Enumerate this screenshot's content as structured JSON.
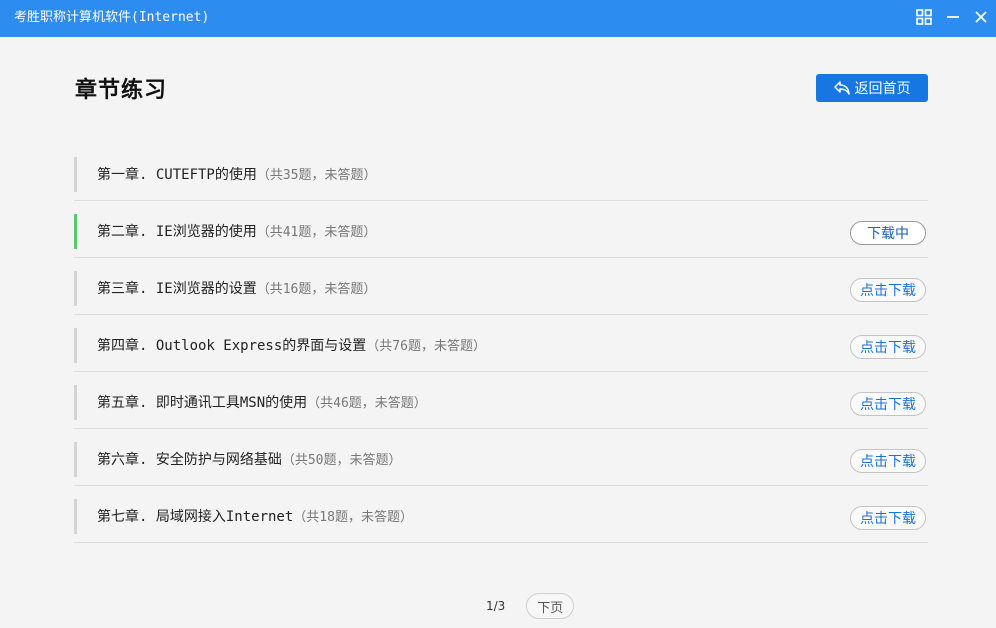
{
  "window": {
    "title": "考胜职称计算机软件(Internet)",
    "controls": {
      "grid_icon": "grid-icon",
      "minimize_icon": "minimize-icon",
      "close_icon": "close-icon"
    }
  },
  "header": {
    "title": "章节练习",
    "home_button": {
      "label": "返回首页",
      "icon": "return-arrow-icon"
    }
  },
  "chapters": [
    {
      "title": "第一章. CUTEFTP的使用",
      "meta": "（共35题，未答题）",
      "active": false,
      "action": ""
    },
    {
      "title": "第二章. IE浏览器的使用",
      "meta": "（共41题，未答题）",
      "active": true,
      "action": "下载中"
    },
    {
      "title": "第三章. IE浏览器的设置",
      "meta": "（共16题，未答题）",
      "active": false,
      "action": "点击下载"
    },
    {
      "title": "第四章. Outlook Express的界面与设置",
      "meta": "（共76题，未答题）",
      "active": false,
      "action": "点击下载"
    },
    {
      "title": "第五章. 即时通讯工具MSN的使用",
      "meta": "（共46题，未答题）",
      "active": false,
      "action": "点击下载"
    },
    {
      "title": "第六章. 安全防护与网络基础",
      "meta": "（共50题，未答题）",
      "active": false,
      "action": "点击下载"
    },
    {
      "title": "第七章. 局域网接入Internet",
      "meta": "（共18题，未答题）",
      "active": false,
      "action": "点击下载"
    }
  ],
  "pagination": {
    "indicator": "1/3",
    "next_label": "下页"
  },
  "colors": {
    "titlebar": "#2d8cf0",
    "primary_button": "#1677e3",
    "active_bar": "#5cc86e",
    "link": "#1a73d9"
  }
}
